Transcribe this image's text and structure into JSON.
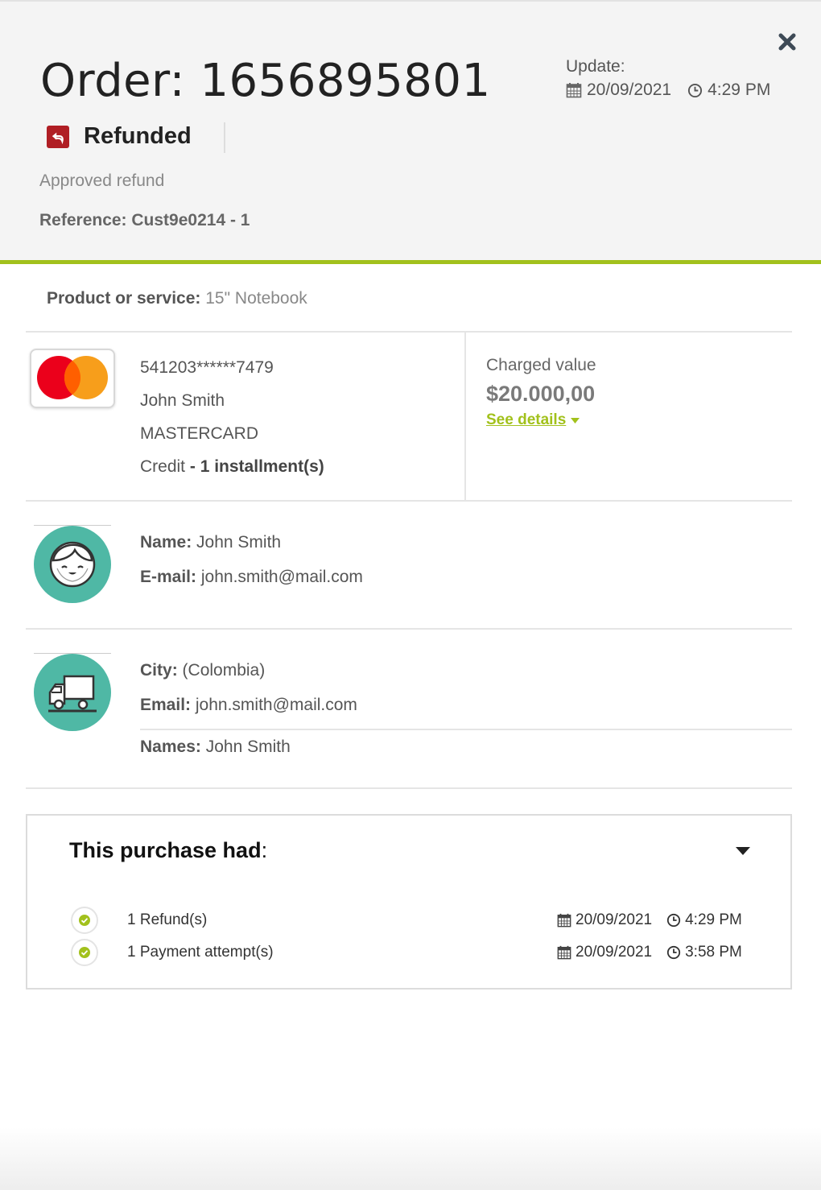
{
  "order": {
    "title_prefix": "Order:",
    "number": "1656895801",
    "update_label": "Update:",
    "update_date": "20/09/2021",
    "update_time": "4:29 PM",
    "status": "Refunded",
    "status_desc": "Approved refund",
    "reference": "Reference: Cust9e0214 - 1"
  },
  "product": {
    "label": "Product or service",
    "value": "15\" Notebook"
  },
  "payment": {
    "card_number": "541203******7479",
    "holder": "John Smith",
    "brand": "MASTERCARD",
    "type": "Credit",
    "installments": "1 installment(s)",
    "charged_label": "Charged value",
    "charged_value": "$20.000,00",
    "see_details": "See details"
  },
  "customer": {
    "name_label": "Name",
    "name": "John Smith",
    "email_label": "E-mail",
    "email": "john.smith@mail.com"
  },
  "shipping": {
    "city_label": "City",
    "city": "(Colombia)",
    "email_label": "Email",
    "email": "john.smith@mail.com",
    "names_label": "Names",
    "names": "John Smith"
  },
  "history": {
    "title": "This purchase had",
    "events": [
      {
        "label": "1 Refund(s)",
        "date": "20/09/2021",
        "time": "4:29 PM"
      },
      {
        "label": "1 Payment attempt(s)",
        "date": "20/09/2021",
        "time": "3:58 PM"
      }
    ]
  },
  "colors": {
    "accent": "#a2c11c",
    "refund_red": "#b01e24",
    "avatar_teal": "#4fb8a5"
  },
  "icons": [
    "close-icon",
    "calendar-icon",
    "clock-icon",
    "refund-icon",
    "mastercard-logo",
    "customer-avatar-icon",
    "truck-icon",
    "check-icon",
    "caret-down-icon"
  ]
}
